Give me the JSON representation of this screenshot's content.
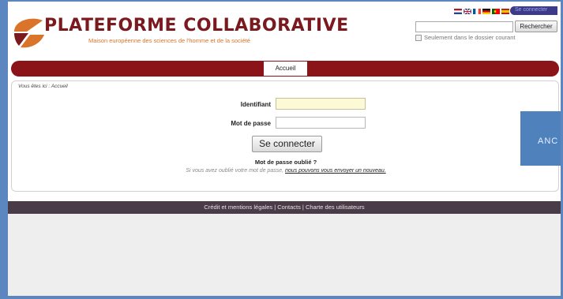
{
  "header": {
    "logo_title": "PLATEFORME COLLABORATIVE",
    "logo_subtitle": "Maison européenne des sciences de l'homme et de la société",
    "top_login_label": "Se connecter",
    "flags": [
      {
        "name": "nl-flag-icon",
        "colors": [
          "#ae1c28",
          "#ffffff",
          "#21468b"
        ]
      },
      {
        "name": "gb-flag-icon",
        "colors": [
          "#012169",
          "#c8102e",
          "#012169"
        ]
      },
      {
        "name": "fr-flag-icon",
        "colors": [
          "#0055a4",
          "#ffffff",
          "#ef4135"
        ]
      },
      {
        "name": "de-flag-icon",
        "colors": [
          "#000000",
          "#dd0000",
          "#ffce00"
        ]
      },
      {
        "name": "pt-flag-icon",
        "colors": [
          "#006600",
          "#ff0000",
          "#ff0000"
        ]
      },
      {
        "name": "es-flag-icon",
        "colors": [
          "#aa151b",
          "#f1bf00",
          "#aa151b"
        ]
      }
    ]
  },
  "search": {
    "value": "",
    "button_label": "Rechercher",
    "option_label": "Seulement dans le dossier courant"
  },
  "nav": {
    "tabs": [
      {
        "label": "Accueil"
      }
    ]
  },
  "breadcrumb": "Vous êtes ici : Accueil",
  "login_form": {
    "identifiant_label": "Identifiant",
    "identifiant_value": "",
    "password_label": "Mot de passe",
    "password_value": "",
    "submit_label": "Se connecter",
    "forgot_title": "Mot de passe oublié ?",
    "forgot_text": "Si vous avez oublié votre mot de passe, ",
    "forgot_link": "nous pouvons vous envoyer un nouveau."
  },
  "footer": {
    "text": "Crédit et mentions légales | Contacts | Charte des utilisateurs"
  },
  "side_tab": {
    "label": "ANC"
  },
  "colors": {
    "brand_dark_red": "#8b1418",
    "logo_orange": "#d9742a",
    "footer_bg": "#4a3b48",
    "frame_blue": "#5b86c0"
  }
}
